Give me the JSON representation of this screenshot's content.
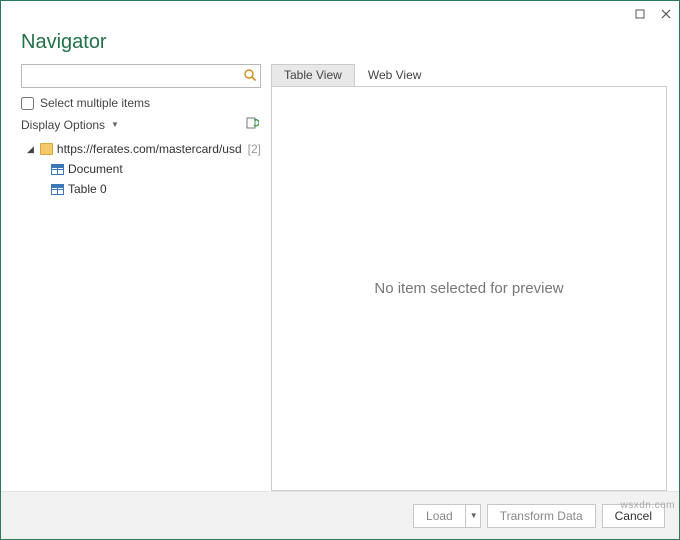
{
  "window": {
    "title": "Navigator"
  },
  "search": {
    "value": "",
    "placeholder": ""
  },
  "options": {
    "select_multiple_label": "Select multiple items",
    "display_options_label": "Display Options"
  },
  "tree": {
    "root_label": "https://ferates.com/mastercard/usd",
    "root_count": "[2]",
    "items": [
      {
        "label": "Document"
      },
      {
        "label": "Table 0"
      }
    ]
  },
  "tabs": {
    "table_view": "Table View",
    "web_view": "Web View"
  },
  "preview": {
    "empty_message": "No item selected for preview"
  },
  "footer": {
    "load": "Load",
    "transform": "Transform Data",
    "cancel": "Cancel"
  },
  "watermark": "wsxdn.com"
}
